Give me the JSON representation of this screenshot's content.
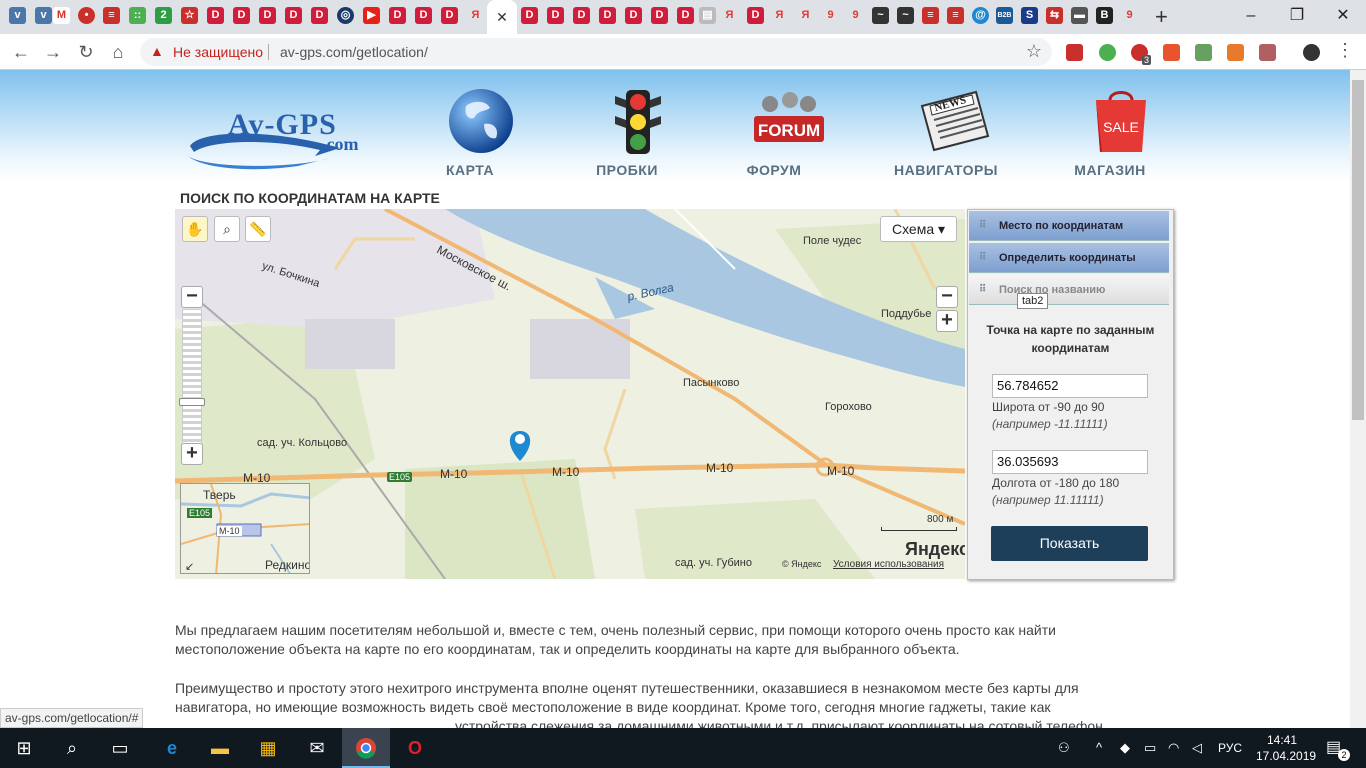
{
  "browser": {
    "active_tab_close": "✕",
    "new_tab": "+",
    "window": {
      "minimize": "–",
      "maximize": "❐",
      "close": "✕"
    },
    "not_secure": "Не защищено",
    "url": "av-gps.com/getlocation/",
    "tab_letters": [
      "D",
      "D",
      "D",
      "D",
      "D",
      "D",
      "D",
      "D",
      "Я",
      "D",
      "D",
      "D",
      "D",
      "D",
      "D",
      "Я",
      "D",
      "Я",
      "Я",
      "B"
    ],
    "extension_badge": "3"
  },
  "site": {
    "logo_main": "Av-GPS",
    "logo_sub": ".com",
    "nav": [
      {
        "label": "КАРТА",
        "icon": "globe-icon"
      },
      {
        "label": "ПРОБКИ",
        "icon": "traffic-light-icon"
      },
      {
        "label": "ФОРУМ",
        "icon": "forum-icon"
      },
      {
        "label": "НАВИГАТОРЫ",
        "icon": "newspaper-icon"
      },
      {
        "label": "МАГАЗИН",
        "icon": "sale-bag-icon"
      }
    ],
    "forum_logo": "FORUM",
    "news_logo": "NEWS",
    "sale_logo": "SALE",
    "page_title": "ПОИСК ПО КООРДИНАТАМ НА КАРТЕ"
  },
  "map": {
    "layer_select": "Схема ▾",
    "labels": {
      "pole": "Поле чудес",
      "street": "ул. Бочкина",
      "highway": "Московское ш.",
      "river": "р. Волга",
      "podd": "Поддубье",
      "pas": "Пасынково",
      "gor": "Горохово",
      "kol": "сад. уч. Кольцово",
      "gub": "сад. уч. Губино",
      "m10": "М-10",
      "e105": "E105"
    },
    "minimap": {
      "tver": "Тверь",
      "redkino": "Редкино",
      "e105": "E105",
      "m10": "М-10"
    },
    "scale": "800 м",
    "yandex": "Яндекс",
    "copyright": "© Яндекс",
    "terms": "Условия использования"
  },
  "panel": {
    "tabs": [
      "Место по координатам",
      "Определить координаты",
      "Поиск по названию"
    ],
    "tooltip": "tab2",
    "title_line1": "Точка на карте по заданным",
    "title_line2": "координатам",
    "lat_value": "56.784652",
    "lat_hint": "Широта от -90 до 90",
    "lat_example": "(например -11.11111)",
    "lon_value": "36.035693",
    "lon_hint": "Долгота от -180 до 180",
    "lon_example": "(например 11.11111)",
    "show_button": "Показать"
  },
  "content": {
    "p1_line1": "Мы предлагаем нашим посетителям небольшой и, вместе с тем, очень полезный сервис, при помощи которого очень просто как найти",
    "p1_line2": "местоположение объекта на карте по его координатам, так и определить координаты на карте для выбранного объекта.",
    "p2_line1": "Преимущество и простоту этого нехитрого инструмента вполне оценят путешественники, оказавшиеся в незнакомом месте без карты для",
    "p2_line2": "навигатора, но имеющие возможность видеть своё местоположение в виде координат. Кроме того, сегодня многие гаджеты, такие как",
    "p2_line3": "устройства слежения за домашними животными и т.д. присылают координаты на сотовый телефон"
  },
  "status_url": "av-gps.com/getlocation/#",
  "taskbar": {
    "lang": "РУС",
    "time": "14:41",
    "date": "17.04.2019",
    "notif": "2"
  },
  "colors": {
    "accent_blue": "#1d3f5a",
    "road_orange": "#f0b872",
    "river_blue": "#a9c7e0",
    "marker_blue": "#1e88d1"
  }
}
